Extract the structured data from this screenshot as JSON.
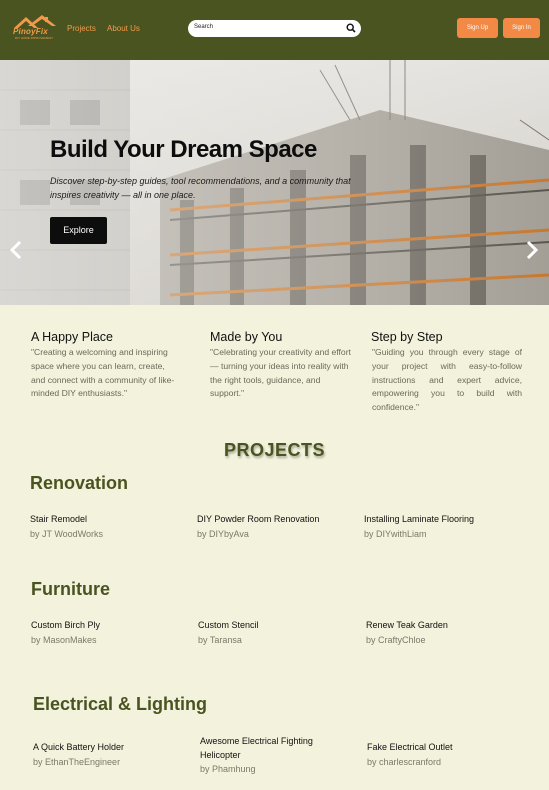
{
  "brand": {
    "name": "PinoyFix",
    "tagline": "DIY HOME IMPROVEMENT"
  },
  "nav": {
    "projects": "Projects",
    "about": "About Us"
  },
  "search": {
    "placeholder": "Search"
  },
  "auth": {
    "signup": "Sign Up",
    "signin": "Sign In"
  },
  "hero": {
    "title": "Build Your Dream Space",
    "subtitle": "Discover step-by-step guides, tool recommendations, and a community that inspires creativity — all in one place.",
    "cta": "Explore"
  },
  "features": [
    {
      "title": "A Happy Place",
      "text": "\"Creating a welcoming and inspiring space where you can learn, create, and connect with a community of like-minded DIY enthusiasts.\""
    },
    {
      "title": "Made by You",
      "text": "\"Celebrating your creativity and effort — turning your ideas into reality with the right tools, guidance, and support.\""
    },
    {
      "title": "Step by Step",
      "text": "\"Guiding you through every stage of your project with easy-to-follow instructions and expert advice, empowering you to build with confidence.\""
    }
  ],
  "projects_heading": "PROJECTS",
  "categories": [
    {
      "name": "Renovation",
      "items": [
        {
          "title": "Stair Remodel",
          "author": "by JT WoodWorks"
        },
        {
          "title": "DIY Powder Room Renovation",
          "author": "by DIYbyAva"
        },
        {
          "title": "Installing Laminate Flooring",
          "author": "by DIYwithLiam"
        }
      ]
    },
    {
      "name": "Furniture",
      "items": [
        {
          "title": "Custom Birch Ply",
          "author": "by MasonMakes"
        },
        {
          "title": "Custom Stencil",
          "author": "by Taransa"
        },
        {
          "title": "Renew Teak Garden",
          "author": "by CraftyChloe"
        }
      ]
    },
    {
      "name": "Electrical & Lighting",
      "items": [
        {
          "title": "A Quick Battery Holder",
          "author": "by EthanTheEngineer"
        },
        {
          "title": "Awesome Electrical Fighting Helicopter",
          "author": "by Phamhung"
        },
        {
          "title": "Fake Electrical Outlet",
          "author": "by charlescranford"
        }
      ]
    }
  ],
  "colors": {
    "header": "#4a5420",
    "accent": "#f28a45",
    "background": "#f3f2dc",
    "heading": "#4a5420"
  },
  "icons": {
    "search": "search-icon",
    "prev": "chevron-left-icon",
    "next": "chevron-right-icon",
    "logo": "house-logo-icon"
  }
}
